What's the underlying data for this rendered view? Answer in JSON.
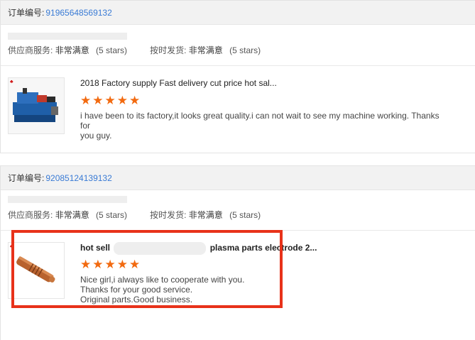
{
  "orders": [
    {
      "order_label": "订单编号:",
      "order_number": "91965648569132",
      "supplier_service_label": "供应商服务:",
      "supplier_service_value": "非常满意",
      "supplier_service_stars": "(5 stars)",
      "ontime_label": "按时发货:",
      "ontime_value": "非常满意",
      "ontime_stars": "(5 stars)",
      "product_title": "2018 Factory supply Fast delivery cut price hot sal...",
      "star_count": 5,
      "review_lines": [
        "i have been to its factory,it looks great quality.i can not wait to see my machine working. Thanks for",
        "you guy."
      ]
    },
    {
      "order_label": "订单编号:",
      "order_number": "92085124139132",
      "supplier_service_label": "供应商服务:",
      "supplier_service_value": "非常满意",
      "supplier_service_stars": "(5 stars)",
      "ontime_label": "按时发货:",
      "ontime_value": "非常满意",
      "ontime_stars": "(5 stars)",
      "product_title_start": "hot sell",
      "product_title_end": "plasma parts electrode 2...",
      "star_count": 5,
      "review_lines": [
        "Nice girl,i always like to cooperate with you.",
        "Thanks for your good service.",
        "Original parts.Good business."
      ]
    }
  ],
  "colors": {
    "link": "#3a7bd5",
    "star": "#f26a10",
    "highlight": "#e8321a"
  }
}
